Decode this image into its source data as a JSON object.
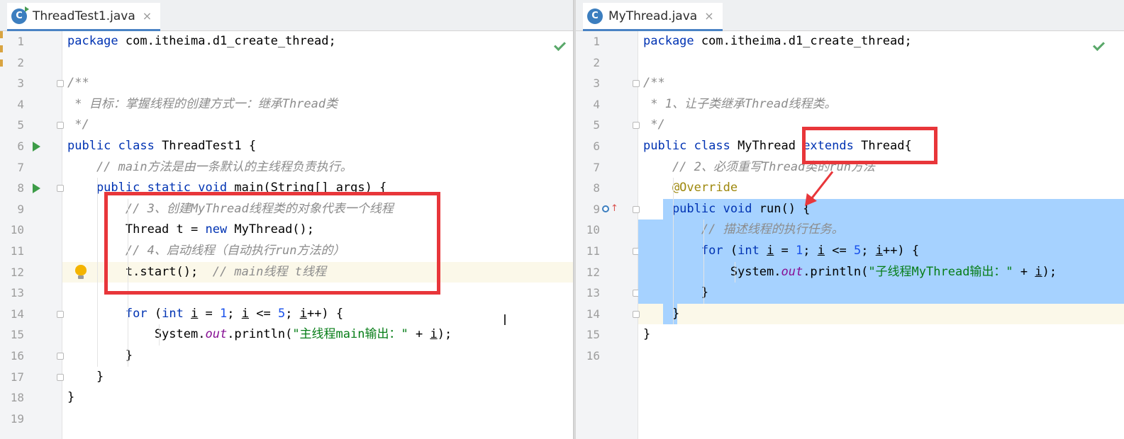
{
  "left_editor": {
    "tab": {
      "icon_letter": "C",
      "label": "ThreadTest1.java",
      "close": "×"
    },
    "lines": [
      {
        "n": "1",
        "tokens": [
          {
            "t": "package",
            "c": "kw"
          },
          {
            "t": " com.itheima.d1_create_thread;",
            "c": ""
          }
        ]
      },
      {
        "n": "2",
        "tokens": []
      },
      {
        "n": "3",
        "tokens": [
          {
            "t": "/**",
            "c": "cmt"
          }
        ]
      },
      {
        "n": "4",
        "tokens": [
          {
            "t": " * 目标：掌握线程的创建方式一：继承Thread类",
            "c": "cmt"
          }
        ]
      },
      {
        "n": "5",
        "tokens": [
          {
            "t": " */",
            "c": "cmt"
          }
        ]
      },
      {
        "n": "6",
        "tokens": [
          {
            "t": "public class",
            "c": "kw"
          },
          {
            "t": " ThreadTest1 {",
            "c": ""
          }
        ]
      },
      {
        "n": "7",
        "tokens": [
          {
            "t": "    // main方法是由一条默认的主线程负责执行。",
            "c": "cmt"
          }
        ]
      },
      {
        "n": "8",
        "tokens": [
          {
            "t": "    public static void",
            "c": "kw"
          },
          {
            "t": " main(String[] args) {",
            "c": ""
          }
        ]
      },
      {
        "n": "9",
        "tokens": [
          {
            "t": "        // 3、创建MyThread线程类的对象代表一个线程",
            "c": "cmt"
          }
        ]
      },
      {
        "n": "10",
        "tokens": [
          {
            "t": "        Thread t = ",
            "c": ""
          },
          {
            "t": "new",
            "c": "kw"
          },
          {
            "t": " MyThread();",
            "c": ""
          }
        ]
      },
      {
        "n": "11",
        "tokens": [
          {
            "t": "        // 4、启动线程（自动执行run方法的）",
            "c": "cmt"
          }
        ]
      },
      {
        "n": "12",
        "tokens": [
          {
            "t": "        t.start();  ",
            "c": ""
          },
          {
            "t": "// main线程 t线程",
            "c": "cmt"
          }
        ]
      },
      {
        "n": "13",
        "tokens": []
      },
      {
        "n": "14",
        "tokens": [
          {
            "t": "        ",
            "c": ""
          },
          {
            "t": "for",
            "c": "kw"
          },
          {
            "t": " (",
            "c": ""
          },
          {
            "t": "int",
            "c": "kw"
          },
          {
            "t": " ",
            "c": ""
          },
          {
            "t": "i",
            "c": "var"
          },
          {
            "t": " = ",
            "c": ""
          },
          {
            "t": "1",
            "c": "num"
          },
          {
            "t": "; ",
            "c": ""
          },
          {
            "t": "i",
            "c": "var"
          },
          {
            "t": " <= ",
            "c": ""
          },
          {
            "t": "5",
            "c": "num"
          },
          {
            "t": "; ",
            "c": ""
          },
          {
            "t": "i",
            "c": "var"
          },
          {
            "t": "++) {",
            "c": ""
          }
        ]
      },
      {
        "n": "15",
        "tokens": [
          {
            "t": "            System.",
            "c": ""
          },
          {
            "t": "out",
            "c": "fld"
          },
          {
            "t": ".println(",
            "c": ""
          },
          {
            "t": "\"主线程main输出：\"",
            "c": "str"
          },
          {
            "t": " + ",
            "c": ""
          },
          {
            "t": "i",
            "c": "var"
          },
          {
            "t": ");",
            "c": ""
          }
        ]
      },
      {
        "n": "16",
        "tokens": [
          {
            "t": "        }",
            "c": ""
          }
        ]
      },
      {
        "n": "17",
        "tokens": [
          {
            "t": "    }",
            "c": ""
          }
        ]
      },
      {
        "n": "18",
        "tokens": [
          {
            "t": "}",
            "c": ""
          }
        ]
      },
      {
        "n": "19",
        "tokens": []
      }
    ]
  },
  "right_editor": {
    "tab": {
      "icon_letter": "C",
      "label": "MyThread.java",
      "close": "×"
    },
    "lines": [
      {
        "n": "1",
        "tokens": [
          {
            "t": "package",
            "c": "kw"
          },
          {
            "t": " com.itheima.d1_create_thread;",
            "c": ""
          }
        ]
      },
      {
        "n": "2",
        "tokens": []
      },
      {
        "n": "3",
        "tokens": [
          {
            "t": "/**",
            "c": "cmt"
          }
        ]
      },
      {
        "n": "4",
        "tokens": [
          {
            "t": " * 1、让子类继承Thread线程类。",
            "c": "cmt"
          }
        ]
      },
      {
        "n": "5",
        "tokens": [
          {
            "t": " */",
            "c": "cmt"
          }
        ]
      },
      {
        "n": "6",
        "tokens": [
          {
            "t": "public class",
            "c": "kw"
          },
          {
            "t": " MyThread ",
            "c": ""
          },
          {
            "t": "extends",
            "c": "kw"
          },
          {
            "t": " Thread{",
            "c": ""
          }
        ]
      },
      {
        "n": "7",
        "tokens": [
          {
            "t": "    // 2、必须重写Thread类的run方法",
            "c": "cmt"
          }
        ]
      },
      {
        "n": "8",
        "tokens": [
          {
            "t": "    @Override",
            "c": "ann"
          }
        ]
      },
      {
        "n": "9",
        "tokens": [
          {
            "t": "    public void",
            "c": "kw"
          },
          {
            "t": " run() {",
            "c": ""
          }
        ]
      },
      {
        "n": "10",
        "tokens": [
          {
            "t": "        // 描述线程的执行任务。",
            "c": "cmt"
          }
        ]
      },
      {
        "n": "11",
        "tokens": [
          {
            "t": "        ",
            "c": ""
          },
          {
            "t": "for",
            "c": "kw"
          },
          {
            "t": " (",
            "c": ""
          },
          {
            "t": "int",
            "c": "kw"
          },
          {
            "t": " ",
            "c": ""
          },
          {
            "t": "i",
            "c": "var"
          },
          {
            "t": " = ",
            "c": ""
          },
          {
            "t": "1",
            "c": "num"
          },
          {
            "t": "; ",
            "c": ""
          },
          {
            "t": "i",
            "c": "var"
          },
          {
            "t": " <= ",
            "c": ""
          },
          {
            "t": "5",
            "c": "num"
          },
          {
            "t": "; ",
            "c": ""
          },
          {
            "t": "i",
            "c": "var"
          },
          {
            "t": "++) {",
            "c": ""
          }
        ]
      },
      {
        "n": "12",
        "tokens": [
          {
            "t": "            System.",
            "c": ""
          },
          {
            "t": "out",
            "c": "fld"
          },
          {
            "t": ".println(",
            "c": ""
          },
          {
            "t": "\"子线程MyThread输出：\"",
            "c": "str"
          },
          {
            "t": " + ",
            "c": ""
          },
          {
            "t": "i",
            "c": "var"
          },
          {
            "t": ");",
            "c": ""
          }
        ]
      },
      {
        "n": "13",
        "tokens": [
          {
            "t": "        }",
            "c": ""
          }
        ]
      },
      {
        "n": "14",
        "tokens": [
          {
            "t": "    }",
            "c": ""
          }
        ]
      },
      {
        "n": "15",
        "tokens": [
          {
            "t": "}",
            "c": ""
          }
        ]
      },
      {
        "n": "16",
        "tokens": []
      }
    ]
  },
  "icons": {
    "file_icon": "java-class-icon",
    "run_gutter": "run-icon",
    "intention": "lightbulb-icon",
    "override_marker": "override-gutter-icon",
    "inspection_ok": "checkmark-icon"
  },
  "colors": {
    "keyword": "#0033b3",
    "comment": "#8c8c8c",
    "string": "#067d17",
    "number": "#1750eb",
    "annotation_box": "#e8363a",
    "selection": "#a6d2ff"
  }
}
